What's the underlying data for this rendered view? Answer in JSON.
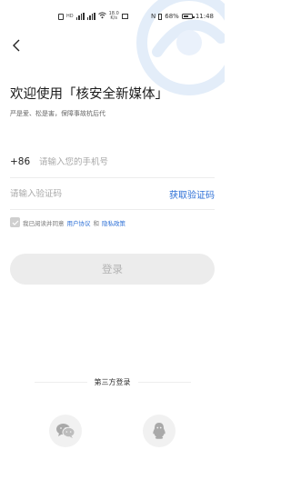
{
  "status_bar": {
    "network_label": "HD",
    "network_speed": "18.0",
    "speed_unit": "K/s",
    "battery": "68%",
    "battery_level": 0.68,
    "time": "11:48"
  },
  "header": {
    "title": "欢迎使用「核安全新媒体」",
    "subtitle": "严是爱、松是害，保障事故杭后代"
  },
  "phone": {
    "country_code": "+86",
    "placeholder": "请输入您的手机号"
  },
  "code": {
    "placeholder": "请输入验证码",
    "get_code_label": "获取验证码"
  },
  "agreement": {
    "prefix": "我已阅读并同意",
    "user_agreement": "用户协议",
    "and": "和",
    "privacy_policy": "隐私政策",
    "checked": false
  },
  "login_button": {
    "label": "登录",
    "enabled": false
  },
  "third_party": {
    "label": "第三方登录",
    "providers": [
      "wechat-icon",
      "qq-icon"
    ]
  },
  "colors": {
    "accent": "#2c6fd6",
    "button_disabled": "#ececec",
    "button_text_disabled": "#b3b3b3",
    "logo_watermark": "#e3edf9"
  }
}
